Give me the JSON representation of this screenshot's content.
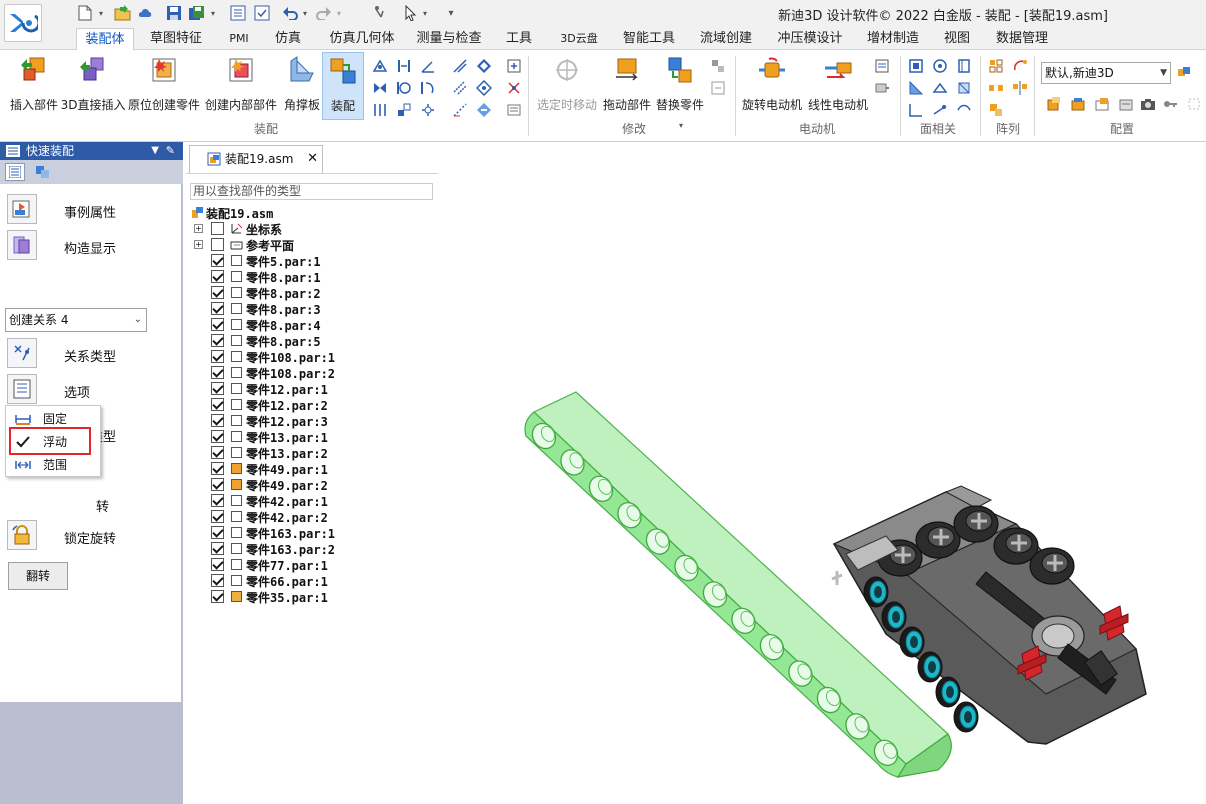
{
  "window_title": "新迪3D 设计软件© 2022 白金版 - 装配 - [装配19.asm]",
  "ribbon_tabs": [
    "装配体",
    "草图特征",
    "PMI",
    "仿真",
    "仿真几何体",
    "测量与检查",
    "工具",
    "3D云盘",
    "智能工具",
    "流域创建",
    "冲压模设计",
    "增材制造",
    "视图",
    "数据管理"
  ],
  "active_tab": "装配体",
  "ribbon": {
    "large_buttons": {
      "insert_part": "插入部件",
      "direct_insert_3d": "3D直接插入",
      "create_in_place": "原位创建零件",
      "create_internal": "创建内部部件",
      "gusset": "角撑板",
      "assemble": "装配",
      "select_move": "选定时移动",
      "drag_part": "拖动部件",
      "replace_part": "替换零件",
      "rotary_motor": "旋转电动机",
      "linear_motor": "线性电动机"
    },
    "groups": {
      "assembly": "装配",
      "modify": "修改",
      "motor": "电动机",
      "face_relate": "面相关",
      "pattern": "阵列",
      "config": "配置"
    },
    "config_select": "默认,新迪3D"
  },
  "left_panel": {
    "title": "快速装配",
    "items": {
      "instance_props": "事例属性",
      "construct_display": "构造显示",
      "relation_select": "创建关系 4",
      "relation_type": "关系类型",
      "options": "选项",
      "offset_type": "偏置类型",
      "lock_rotate": "锁定旋转",
      "hidden_rotate_fragment": "转"
    },
    "offset_popup": [
      "固定",
      "浮动",
      "范围"
    ],
    "offset_popup_selected": "浮动",
    "flip_button": "翻转"
  },
  "document_tab": "装配19.asm",
  "search_placeholder": "用以查找部件的类型",
  "tree": {
    "root": "装配19.asm",
    "folders": [
      "坐标系",
      "参考平面"
    ],
    "parts": [
      "零件5.par:1",
      "零件8.par:1",
      "零件8.par:2",
      "零件8.par:3",
      "零件8.par:4",
      "零件8.par:5",
      "零件108.par:1",
      "零件108.par:2",
      "零件12.par:1",
      "零件12.par:2",
      "零件12.par:3",
      "零件13.par:1",
      "零件13.par:2",
      "零件49.par:1",
      "零件49.par:2",
      "零件42.par:1",
      "零件42.par:2",
      "零件163.par:1",
      "零件163.par:2",
      "零件77.par:1",
      "零件66.par:1",
      "零件35.par:1"
    ],
    "part_icon_colors": [
      "#ffffff",
      "#ffffff",
      "#ffffff",
      "#ffffff",
      "#ffffff",
      "#ffffff",
      "#ffffff",
      "#ffffff",
      "#ffffff",
      "#ffffff",
      "#ffffff",
      "#ffffff",
      "#ffffff",
      "#f0a030",
      "#f0a030",
      "#ffffff",
      "#ffffff",
      "#ffffff",
      "#ffffff",
      "#ffffff",
      "#ffffff",
      "#f0b040"
    ]
  },
  "colors": {
    "accent": "#0b57c9",
    "panel_header": "#2e5aa6",
    "beam_green": "#8fe68f",
    "part_gray": "#5a5a5a",
    "hole_cyan": "#1fb6c9",
    "pin_red": "#d6262c"
  }
}
